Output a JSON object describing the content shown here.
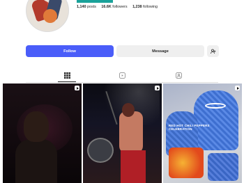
{
  "profile": {
    "stats": {
      "posts_count": "1,140",
      "posts_label": "posts",
      "followers_count": "16.6K",
      "followers_label": "followers",
      "following_count": "1,238",
      "following_label": "following"
    }
  },
  "actions": {
    "follow_label": "Follow",
    "message_label": "Message",
    "suggest_icon": "add-person-icon"
  },
  "tabs": [
    {
      "icon": "grid-icon",
      "active": true
    },
    {
      "icon": "reels-icon",
      "active": false
    },
    {
      "icon": "tagged-icon",
      "active": false
    }
  ],
  "grid": {
    "item3_caption": "RED HOT CHILI PEPPERS CELEBRATION"
  },
  "colors": {
    "follow_button": "#4a5df9",
    "secondary_button": "#efefef",
    "accent_strip": "#1aa29a"
  }
}
